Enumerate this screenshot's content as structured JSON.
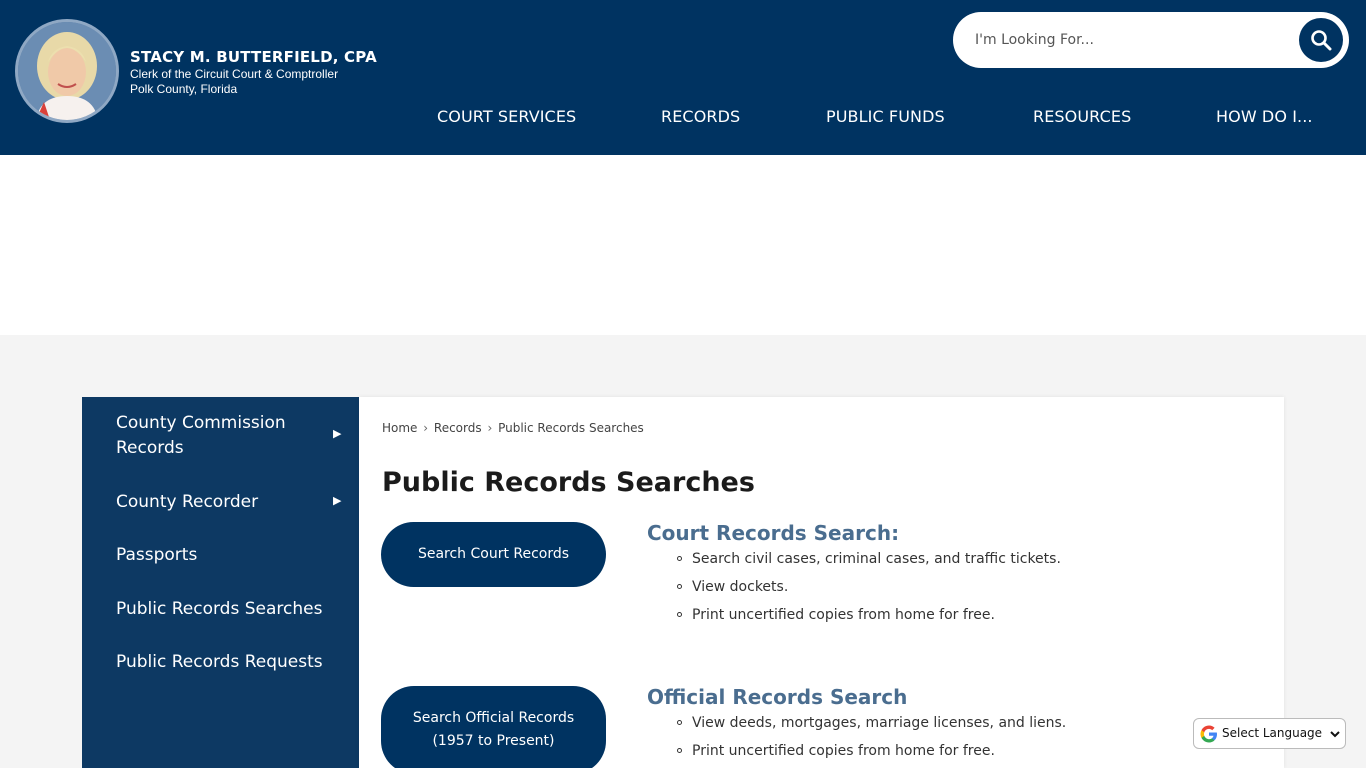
{
  "header": {
    "name": "STACY M. BUTTERFIELD, CPA",
    "subtitle_line1": "Clerk of the Circuit Court & Comptroller",
    "subtitle_line2": "Polk County, Florida",
    "search_placeholder": "I'm Looking For...",
    "nav": [
      "COURT SERVICES",
      "RECORDS",
      "PUBLIC FUNDS",
      "RESOURCES",
      "HOW DO I..."
    ]
  },
  "sidebar": {
    "items": [
      {
        "label": "County Commission Records",
        "has_submenu": true
      },
      {
        "label": "County Recorder",
        "has_submenu": true
      },
      {
        "label": "Passports",
        "has_submenu": false
      },
      {
        "label": "Public Records Searches",
        "has_submenu": false
      },
      {
        "label": "Public Records Requests",
        "has_submenu": false
      }
    ]
  },
  "breadcrumb": {
    "home": "Home",
    "records": "Records",
    "current": "Public Records Searches",
    "separator": "›"
  },
  "main": {
    "title": "Public Records Searches",
    "sections": [
      {
        "button_label": "Search Court Records",
        "heading": "Court Records Search:",
        "bullets": [
          "Search civil cases, criminal cases, and traffic tickets.",
          "View dockets.",
          "Print uncertified copies from home for free."
        ]
      },
      {
        "button_label_line1": "Search Official Records",
        "button_label_line2": "(1957 to Present)",
        "heading": "Official Records Search",
        "bullets": [
          "View deeds, mortgages, marriage licenses, and liens.",
          "Print uncertified copies from home for free."
        ]
      }
    ]
  },
  "language_selector": {
    "label": "Select Language"
  },
  "icons": {
    "search": "search-icon",
    "arrow": "triangle-right-icon",
    "google": "google-g-icon",
    "chevron": "chevron-down-icon"
  },
  "colors": {
    "header_bg": "#003361",
    "sidebar_bg": "#0d3963",
    "section_heading": "#4a6d8f",
    "page_bg": "#f4f4f4"
  }
}
